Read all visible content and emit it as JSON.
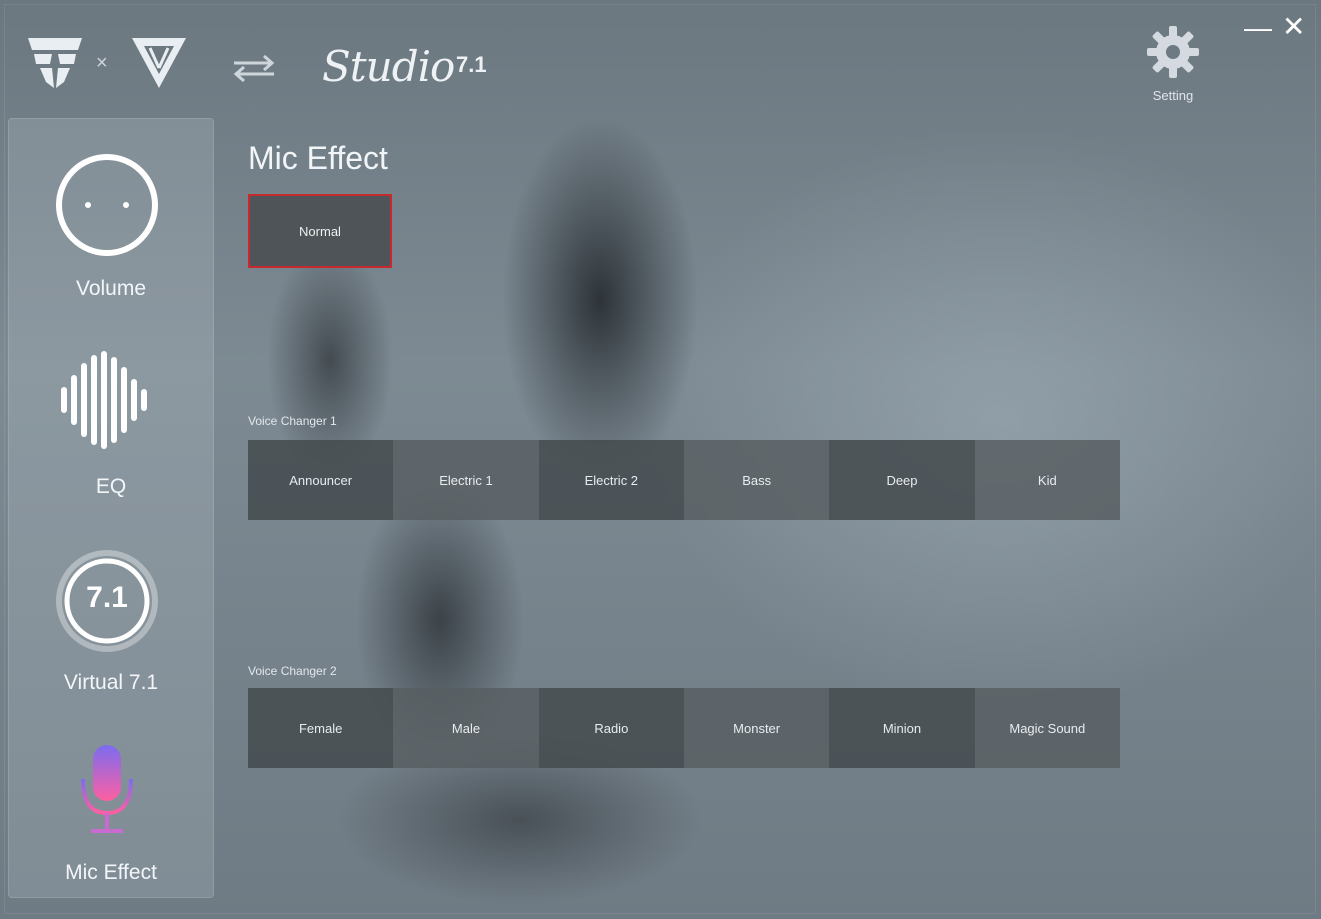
{
  "header": {
    "cross": "×",
    "logo_text": "Studio",
    "logo_version": "7.1",
    "setting_label": "Setting",
    "minimize": "—",
    "close": "✕"
  },
  "icons": {
    "brand_left": "brand-logo-icon",
    "brand_right": "triangle-logo-icon",
    "swap": "swap-arrows-icon",
    "gear": "gear-icon",
    "volume": "volume-knob-icon",
    "eq": "equalizer-icon",
    "virtual": "virtual-7.1-icon",
    "mic": "microphone-icon"
  },
  "sidebar": {
    "items": [
      {
        "label": "Volume"
      },
      {
        "label": "EQ"
      },
      {
        "label": "Virtual 7.1",
        "badge": "7.1"
      },
      {
        "label": "Mic Effect"
      }
    ]
  },
  "main": {
    "title": "Mic Effect",
    "normal_label": "Normal",
    "voice_changer_1": {
      "label": "Voice Changer 1",
      "buttons": [
        "Announcer",
        "Electric 1",
        "Electric 2",
        "Bass",
        "Deep",
        "Kid"
      ]
    },
    "voice_changer_2": {
      "label": "Voice Changer 2",
      "buttons": [
        "Female",
        "Male",
        "Radio",
        "Monster",
        "Minion",
        "Magic Sound"
      ]
    }
  },
  "colors": {
    "selected_border": "#c62a2f",
    "mic_gradient_top": "#7b6cf0",
    "mic_gradient_bottom": "#ff5fa2"
  }
}
